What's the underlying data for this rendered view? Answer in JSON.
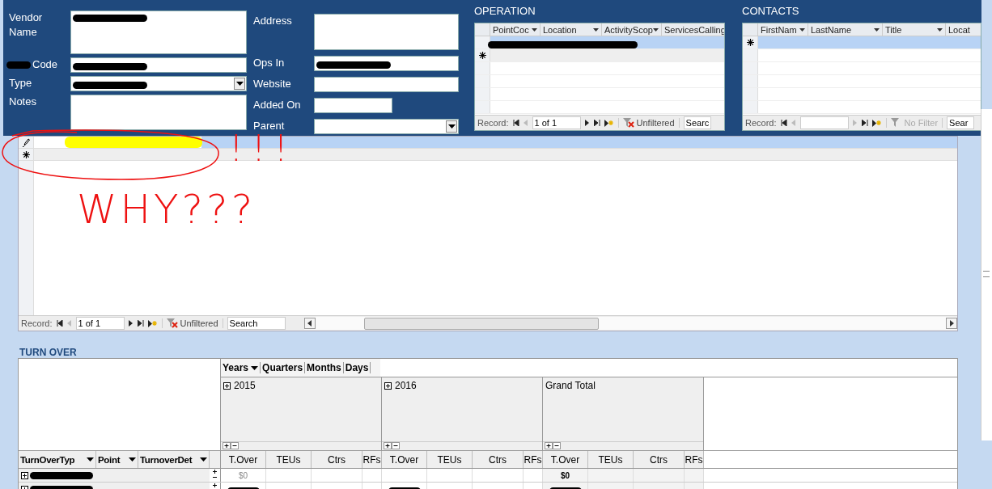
{
  "form": {
    "left_fields": [
      {
        "label": "Vendor Name",
        "kind": "memo",
        "redacted": true,
        "label_redacted": false
      },
      {
        "label": "Code",
        "kind": "text",
        "redacted": true,
        "label_redacted": true
      },
      {
        "label": "Type",
        "kind": "combo",
        "redacted": true,
        "label_redacted": false
      },
      {
        "label": "Notes",
        "kind": "memo",
        "redacted": false,
        "label_redacted": false
      }
    ],
    "right_fields": [
      {
        "label": "Address",
        "kind": "memo",
        "redacted": false
      },
      {
        "label": "Ops In",
        "kind": "text",
        "redacted": true
      },
      {
        "label": "Website",
        "kind": "text",
        "redacted": false
      },
      {
        "label": "Added On",
        "kind": "date",
        "redacted": false
      },
      {
        "label": "Parent",
        "kind": "combo",
        "redacted": false
      }
    ]
  },
  "subforms": [
    {
      "title": "OPERATION",
      "columns": [
        "PointCoc",
        "Location",
        "ActivityScop",
        "ServicesCalling"
      ],
      "records": [
        {
          "kind": "record",
          "selected": true,
          "redacted": true
        },
        {
          "kind": "new",
          "selected": false
        }
      ],
      "nav": {
        "label": "Record:",
        "position": "1 of 1",
        "filter": "Unfiltered",
        "filter_active": true,
        "search": "Searc"
      }
    },
    {
      "title": "CONTACTS",
      "columns": [
        "FirstNam",
        "LastName",
        "Title",
        "Locat"
      ],
      "records": [
        {
          "kind": "new",
          "selected": true
        }
      ],
      "nav": {
        "label": "Record:",
        "filter": "No Filter",
        "filter_active": false,
        "search": "Sear"
      }
    }
  ],
  "datasheet": {
    "records": [
      {
        "kind": "record",
        "selected": true,
        "highlighted": true
      },
      {
        "kind": "new",
        "selected": false,
        "highlighted": false
      }
    ],
    "nav": {
      "label": "Record:",
      "position": "1 of 1",
      "filter": "Unfiltered",
      "filter_active": true,
      "search": "Search"
    }
  },
  "annotations": [
    {
      "text": "!!!"
    },
    {
      "text": "WHY???"
    }
  ],
  "turn_over": {
    "title": "TURN OVER",
    "column_fields": [
      "Years",
      "Quarters",
      "Months",
      "Days"
    ],
    "groups": [
      {
        "label": "2015",
        "kind": "year",
        "measures": [
          "T.Over",
          "TEUs",
          "Ctrs",
          "RFs"
        ]
      },
      {
        "label": "2016",
        "kind": "year",
        "measures": [
          "T.Over",
          "TEUs",
          "Ctrs",
          "RFs"
        ]
      },
      {
        "label": "Grand Total",
        "kind": "total",
        "measures": [
          "T.Over",
          "TEUs",
          "Ctrs",
          "RFs"
        ]
      }
    ],
    "row_fields": [
      "TurnOverTyp",
      "Point",
      "TurnoverDet"
    ],
    "rows": [
      {
        "redacted": true,
        "t_over": [
          {
            "kind": "value",
            "text": "$0"
          },
          {
            "kind": "empty"
          },
          {
            "kind": "value",
            "text": "$0"
          }
        ]
      },
      {
        "redacted": true,
        "t_over": [
          {
            "kind": "redacted"
          },
          {
            "kind": "redacted"
          },
          {
            "kind": "redacted"
          }
        ]
      }
    ]
  }
}
